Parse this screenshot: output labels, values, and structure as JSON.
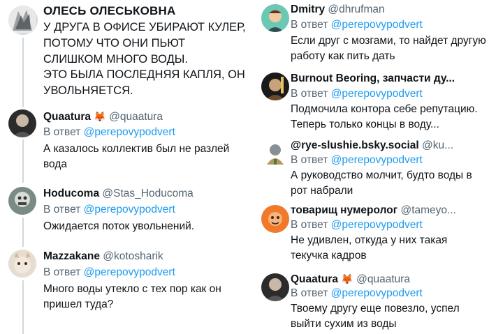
{
  "left": {
    "op": {
      "name": "ОЛЕСЬ ОЛЕСЬКОВНА",
      "text_1": "У ДРУГА В ОФИСЕ УБИРАЮТ КУЛЕР, ПОТОМУ ЧТО ОНИ ПЬЮТ СЛИШКОМ МНОГО ВОДЫ.",
      "text_2": "ЭТО БЫЛА ПОСЛЕДНЯЯ КАПЛЯ, ОН УВОЛЬНЯЕТСЯ."
    },
    "replies": [
      {
        "name": "Quaatura",
        "fox": "🦊",
        "handle": "@quaatura",
        "reply_prefix": "В ответ",
        "mention": "@perepovypodvert",
        "text": "А казалось коллектив был не разлей вода"
      },
      {
        "name": "Hoducoma",
        "handle": "@Stas_Hoducoma",
        "reply_prefix": "В ответ",
        "mention": "@perepovypodvert",
        "text": "Ожидается поток увольнений."
      },
      {
        "name": "Mazzakane",
        "handle": "@kotosharik",
        "reply_prefix": "В ответ",
        "mention": "@perepovypodvert",
        "text": "Много воды утекло с тех пор как он пришел туда?"
      }
    ]
  },
  "right": {
    "replies": [
      {
        "name": "Dmitry",
        "handle": "@dhrufman",
        "reply_prefix": "В ответ",
        "mention": "@perepovypodvert",
        "text": "Если друг с мозгами, то найдет другую работу как пить дать"
      },
      {
        "name": "Burnout Beoring, запчасти ду...",
        "handle": "",
        "reply_prefix": "В ответ",
        "mention": "@perepovypodvert",
        "text": "Подмочила контора себе репутацию. Теперь только концы в воду..."
      },
      {
        "name": "@rye-slushie.bsky.social",
        "handle": "@ku...",
        "reply_prefix": "В ответ",
        "mention": "@perepovypodvert",
        "text": "А руководство молчит, будто воды в рот набрали"
      },
      {
        "name": "товарищ нумеролог",
        "handle": "@tameyo...",
        "reply_prefix": "В ответ",
        "mention": "@perepovypodvert",
        "text": "Не удивлен, откуда у них такая текучка кадров"
      },
      {
        "name": "Quaatura",
        "fox": "🦊",
        "handle": "@quaatura",
        "reply_prefix": "В ответ",
        "mention": "@perepovypodvert",
        "text": "Твоему другу еще повезло, успел выйти сухим из воды"
      }
    ]
  },
  "colors": {
    "mention": "#1d9bf0",
    "handle": "#536471",
    "text": "#0f1419",
    "thread_line": "#cfd9de"
  }
}
